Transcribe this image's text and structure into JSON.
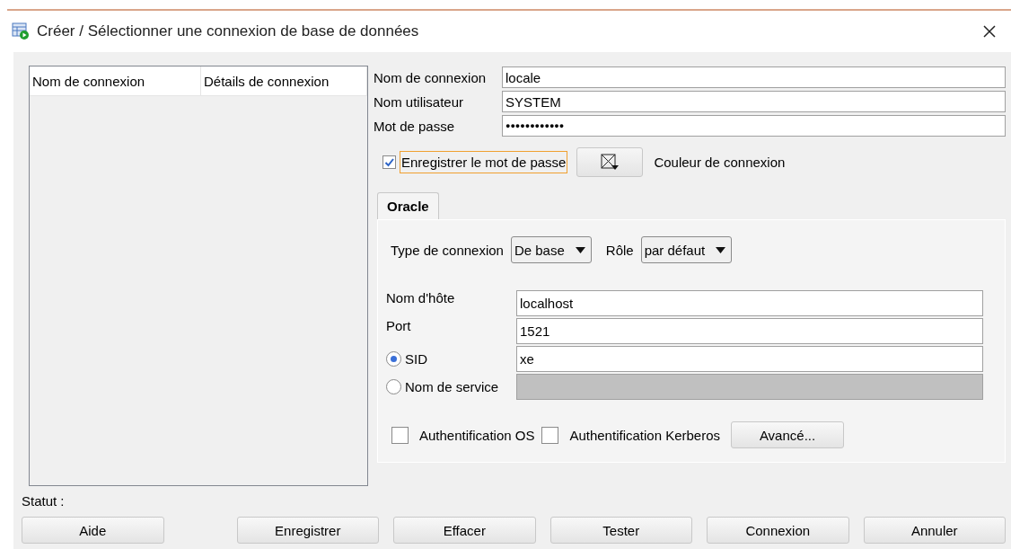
{
  "window": {
    "title": "Créer / Sélectionner une connexion de base de données"
  },
  "connection_list": {
    "columns": [
      "Nom de connexion",
      "Détails de connexion"
    ]
  },
  "form": {
    "fields": [
      {
        "label": "Nom de connexion",
        "value": "locale",
        "kind": "text"
      },
      {
        "label": "Nom utilisateur",
        "value": "SYSTEM",
        "kind": "text"
      },
      {
        "label": "Mot de passe",
        "value": "●●●●●●●●●●●●",
        "kind": "password"
      }
    ],
    "save_password": {
      "label": "Enregistrer le mot de passe",
      "checked": true,
      "focused": true
    },
    "color_label": "Couleur de connexion"
  },
  "tabs": [
    {
      "label": "Oracle",
      "selected": true
    }
  ],
  "oracle": {
    "type_label": "Type de connexion",
    "type_value": "De base",
    "role_label": "Rôle",
    "role_value": "par défaut",
    "fields": [
      {
        "kind": "text",
        "label": "Nom d'hôte",
        "value": "localhost",
        "disabled": false
      },
      {
        "kind": "text",
        "label": "Port",
        "value": "1521",
        "disabled": false
      },
      {
        "kind": "radio",
        "label": "SID",
        "value": "xe",
        "selected": true,
        "disabled": false
      },
      {
        "kind": "radio",
        "label": "Nom de service",
        "selected": false,
        "disabled": true
      }
    ],
    "checkboxes": [
      {
        "label": "Authentification OS",
        "checked": false
      },
      {
        "label": "Authentification Kerberos",
        "checked": false
      }
    ],
    "advanced_button": "Avancé..."
  },
  "status_label": "Statut :",
  "buttons": [
    "Aide",
    "Enregistrer",
    "Effacer",
    "Tester",
    "Connexion",
    "Annuler"
  ]
}
